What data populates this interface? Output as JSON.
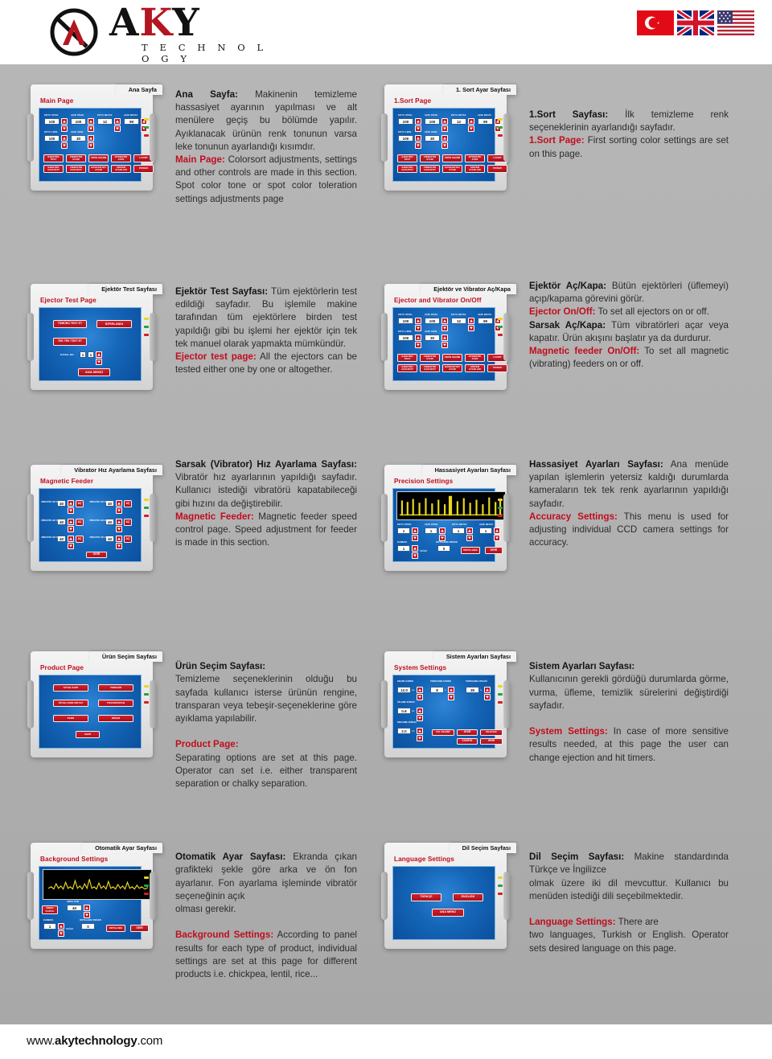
{
  "brand": {
    "name_a": "A",
    "name_k": "K",
    "name_y": "Y",
    "tagline": "T E C H N O L O G Y",
    "logo_icon": "aky-circle-logo"
  },
  "flags": [
    {
      "name": "turkey-flag",
      "label": "Türkiye"
    },
    {
      "name": "uk-flag",
      "label": "United Kingdom"
    },
    {
      "name": "usa-flag",
      "label": "United States"
    }
  ],
  "footer": {
    "url_prefix": "www.",
    "url_bold": "akytechnology",
    "url_suffix": ".com"
  },
  "sections": [
    {
      "tab": "Ana Sayfa",
      "panel_title": "Main Page",
      "fields": [
        {
          "label": "KOYU SİYAH",
          "value": "100"
        },
        {
          "label": "AÇIK SİYAH",
          "value": "100"
        },
        {
          "label": "KOYU BEYAZ",
          "value": "12"
        },
        {
          "label": "AÇIK BEYAZ",
          "value": "99"
        },
        {
          "label": "KOYU LEKE",
          "value": "100"
        },
        {
          "label": "AÇIK LEKE",
          "value": "30"
        }
      ],
      "buttons": [
        "EJEKTÖR TEST",
        "VİBRATÖR AYARI",
        "ÜRÜN SEÇİMİ",
        "OTOMATİK AYAR",
        "1.SORT",
        "EJEKTÖR AÇ/KAPAT",
        "VİBRATÖR AÇ/KAPAT",
        "HASSASİYET AYARI",
        "SİSTEM AYARLARI",
        "POWER"
      ],
      "tr_head": "Ana Sayfa:",
      "tr_body": " Makinenin temizleme hassasiyet ayarının yapılması ve alt menülere geçiş bu bölümde yapılır. Ayıklanacak ürünün renk tonunun varsa leke tonunun ayarlandığı kısımdır.",
      "en_head": "Main Page:",
      "en_body": " Colorsort adjustments, settings and other controls are made in this section. Spot color tone or spot color toleration settings adjustments page"
    },
    {
      "tab": "1. Sort Ayar Sayfası",
      "panel_title": "1.Sort Page",
      "fields": [
        {
          "label": "KOYU SİYAH",
          "value": "100"
        },
        {
          "label": "AÇIK SİYAH",
          "value": "100"
        },
        {
          "label": "KOYU BEYAZ",
          "value": "12"
        },
        {
          "label": "AÇIK BEYAZ",
          "value": "99"
        },
        {
          "label": "KOYU LEKE",
          "value": "100"
        },
        {
          "label": "AÇIK LEKE",
          "value": "30"
        }
      ],
      "buttons": [
        "EJEKTÖR TEST",
        "VİBRATÖR AYARI",
        "ÜRÜN SEÇİMİ",
        "OTOMATİK AYAR",
        "1.SORT",
        "EJEKTÖR AÇ/KAPAT",
        "VİBRATÖR AÇ/KAPAT",
        "HASSASİYET AYARI",
        "SİSTEM AYARLARI",
        "POWER"
      ],
      "tr_head": "1.Sort Sayfası:",
      "tr_body": " İlk temizleme renk seçeneklerinin ayarlandığı sayfadır.",
      "en_head": "1.Sort Page:",
      "en_body": " First sorting color settings are set on this page."
    },
    {
      "tab": "Ejektör Test Sayfası",
      "panel_title": "Ejector Test Page",
      "buttons": [
        "TÜMÜNÜ TEST ET",
        "SIFIRLAMA",
        "TEK TEK TEST ET",
        "ANA MENÜ"
      ],
      "fields": [
        {
          "label": "KANAL NO",
          "value": "1",
          "value2": "1"
        }
      ],
      "tr_head": "Ejektör Test Sayfası:",
      "tr_body": " Tüm ejektörlerin test edildiği sayfadır. Bu işlemile makine tarafından tüm ejektörlere birden test yapıldığı gibi bu işlemi her ejektör için tek tek manuel olarak yapmakta mümkündür.",
      "en_head": "Ejector test page:",
      "en_body": " All the ejectors can be tested either one by one or altogether."
    },
    {
      "tab": "Ejektör ve Vibrator Aç/Kapa",
      "panel_title": "Ejector and Vibrator On/Off",
      "fields": [
        {
          "label": "KOYU SİYAH",
          "value": "100"
        },
        {
          "label": "AÇIK SİYAH",
          "value": "100"
        },
        {
          "label": "KOYU BEYAZ",
          "value": "12"
        },
        {
          "label": "AÇIK BEYAZ",
          "value": "99"
        },
        {
          "label": "KOYU LEKE",
          "value": "100"
        },
        {
          "label": "AÇIK LEKE",
          "value": "30"
        }
      ],
      "buttons": [
        "EJEKTÖR TEST",
        "VİBRATÖR AYARI",
        "ÜRÜN SEÇİMİ",
        "OTOMATİK AYAR",
        "1.SORT",
        "EJEKTÖR AÇ/KAPAT",
        "VİBRATÖR AÇ/KAPAT",
        "HASSASİYET AYARI",
        "SİSTEM AYARLARI",
        "POWER"
      ],
      "tr_head": "Ejektör Aç/Kapa:",
      "tr_body": " Bütün ejektörleri (üflemeyi) açıp/kapama görevini görür.",
      "en_head": "Ejector On/Off:",
      "en_body": " To set all ejectors on or off.",
      "tr_head2": "Sarsak Aç/Kapa:",
      "tr_body2": " Tüm vibratörleri açar veya kapatır. Ürün akışını başlatır ya da durdurur.",
      "en_head2": "Magnetic feeder On/Off:",
      "en_body2": " To set all magnetic (vibrating) feeders on or off."
    },
    {
      "tab": "Vibrator Hız Ayarlama Sayfası",
      "panel_title": "Magnetic Feeder",
      "fields": [
        {
          "label": "VİBRATÖR HIZ AYARI-1",
          "value": "40"
        },
        {
          "label": "VİBRATÖR HIZ AYARI-4",
          "value": "40"
        },
        {
          "label": "VİBRATÖR HIZ AYARI-2",
          "value": "40"
        },
        {
          "label": "VİBRATÖR HIZ AYARI-5",
          "value": "40"
        },
        {
          "label": "VİBRATÖR HIZ AYARI-3",
          "value": "40"
        },
        {
          "label": "VİBRATÖR HIZ AYARI-6",
          "value": "40"
        }
      ],
      "toggle_label": "AÇ",
      "buttons": [
        "GERİ"
      ],
      "tr_head": "Sarsak (Vibrator) Hız Ayarlama Sayfası:",
      "tr_body": " Vibratör hız ayarlarının yapıldığı sayfadır. Kullanıcı istediği vibratörü kapatabileceği gibi hızını da değiştirebilir.",
      "en_head": "Magnetic Feeder:",
      "en_body": " Magnetic feeder speed control page. Speed adjustment for feeder is made in this section."
    },
    {
      "tab": "Hassasiyet Ayarları Sayfası",
      "panel_title": "Precision Settings",
      "graph": "yellow-bar-waveform",
      "fields": [
        {
          "label": "KOYU SİYAH",
          "value": "1"
        },
        {
          "label": "AÇIK SİYAH",
          "value": "1"
        },
        {
          "label": "KOYU BEYAZ",
          "value": "1"
        },
        {
          "label": "AÇIK BEYAZ",
          "value": "1"
        },
        {
          "label": "KAMERA",
          "value": "1"
        },
        {
          "label": "ORTALAMA DEĞER",
          "value": "0"
        }
      ],
      "buttons": [
        "ORTALAMA",
        "GERİ"
      ],
      "extra_label": "DEĞER",
      "tr_head": "Hassasiyet Ayarları Sayfası:",
      "tr_body": " Ana menüde yapılan işlemlerin yetersiz kaldığı durumlarda kameraların tek tek renk ayarlarının yapıldığı sayfadır.",
      "en_head": "Accuracy Settings:",
      "en_body": " This menu is used for adjusting individual CCD camera settings for accuracy."
    },
    {
      "tab": "Ürün Seçim Sayfası",
      "panel_title": "Product Page",
      "buttons": [
        "SİYAH-SARI",
        "TEBEŞİR",
        "SİYAH-SARI-BEYAZ",
        "TRANSPARAN",
        "TERS",
        "DİĞER",
        "GERİ"
      ],
      "tr_head": "Ürün Seçim Sayfası:",
      "tr_body": "\nTemizleme seçeneklerinin olduğu bu sayfada kullanıcı isterse ürünün rengine, transparan veya tebeşir-seçeneklerine göre ayıklama yapılabilir.",
      "en_head": "Product Page:",
      "en_body": "\nSeparating options are set at this page. Operator can set i.e. either transparent separation or chalky separation."
    },
    {
      "tab": "Sistem Ayarları Sayfası",
      "panel_title": "System Settings",
      "fields": [
        {
          "label": "SEÇME SÜRESİ",
          "value": "12.0",
          "unit": "ms"
        },
        {
          "label": "TEMİZLEME SÜRESİ",
          "value": "8",
          "unit": "s"
        },
        {
          "label": "TEMİZLEME ARALIĞI",
          "value": "35",
          "unit": "m"
        },
        {
          "label": "ÜFLEME SÜRESİ",
          "value": "0.6",
          "unit": "ms"
        },
        {
          "label": "BEKLEME SÜRESİ",
          "value": "2.0",
          "unit": "ms"
        }
      ],
      "buttons": [
        "DİL SEÇİMİ",
        "AYAR",
        "SİLECEK",
        "CONFIG",
        "GERİ"
      ],
      "tr_head": "Sistem Ayarları Sayfası:",
      "tr_body": "\nKullanıcının gerekli gördüğü durumlarda görme, vurma, üfleme, temizlik sürelerini değiştirdiği sayfadır.",
      "en_head": "System Settings:",
      "en_body": " In case of more sensitive results needed, at this page the user can change ejection and hit timers."
    },
    {
      "tab": "Otomatik Ayar Sayfası",
      "panel_title": "Background Settings",
      "graph": "yellow-line-waveform",
      "fields": [
        {
          "label": "ARKA FON",
          "value": "40"
        },
        {
          "label": "KAMERA",
          "value": "1"
        },
        {
          "label": "ORTALAMA DEĞER",
          "value": "0"
        }
      ],
      "buttons": [
        "VİBRO KAPALI",
        "ORTALAMA",
        "GERİ"
      ],
      "extra_label": "DEĞER",
      "tr_head": "Otomatik Ayar Sayfası:",
      "tr_body": " Ekranda çıkan grafikteki şekle göre arka ve ön fon ayarlanır. Fon ayarlama işleminde vibratör seçeneğinin açık\nolması gerekir.",
      "en_head": "Background Settings:",
      "en_body": " According to panel results for each type of product, individual settings are set at this page for different products i.e. chickpea, lentil, rice..."
    },
    {
      "tab": "Dil Seçim Sayfası",
      "panel_title": "Language Settings",
      "buttons": [
        "TÜRKÇE",
        "ENGLISH",
        "ANA MENÜ"
      ],
      "tr_head": "Dil Seçim Sayfası:",
      "tr_body": " Makine standardında Türkçe ve İngilizce\nolmak üzere iki dil mevcuttur. Kullanıcı bu menüden istediği dili seçebilmektedir.",
      "en_head": "Language Settings:",
      "en_body": " There are\ntwo languages, Turkish or English. Operator sets desired language on this page."
    }
  ]
}
